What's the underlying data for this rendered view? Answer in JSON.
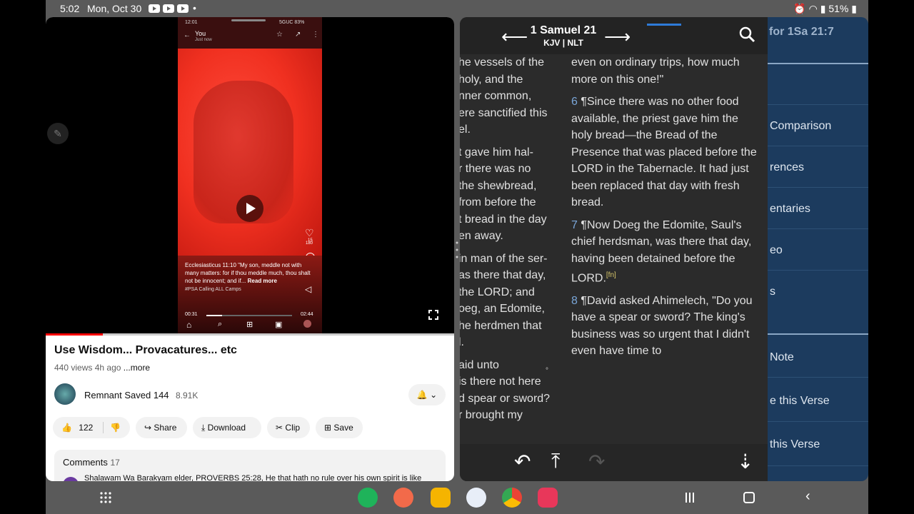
{
  "status_bar": {
    "time": "5:02",
    "date": "Mon, Oct 30",
    "battery": "51%"
  },
  "youtube": {
    "phone_overlay": {
      "carrier_time": "12:01",
      "carrier": "5GUC 83%",
      "user": "You",
      "posted": "Just now",
      "likes": "180",
      "comments": "15",
      "caption_ref": "Ecclesiasticus 11:10",
      "caption_text": "\"My son, meddle not with many matters: for if thou meddle much, thou shalt not be innocent; and if...",
      "read_more": "Read more",
      "hashtag": "#PSA Calling ALL Camps",
      "elapsed": "00:31",
      "duration": "02:44"
    },
    "progress_percent": 14,
    "title": "Use Wisdom... Provacatures... etc",
    "views": "440 views",
    "age": "4h ago",
    "more": "...more",
    "channel": "Remnant Saved 144",
    "subscribers": "8.91K",
    "actions": {
      "likes": "122",
      "share": "Share",
      "download": "Download",
      "clip": "Clip",
      "save": "Save"
    },
    "comments": {
      "label": "Comments",
      "count": "17",
      "preview": "Shalawam Wa Barakyam elder, PROVERBS 25:28, He that hath no rule over his own spirit is like"
    }
  },
  "bible": {
    "book_chapter": "1 Samuel 21",
    "versions": "KJV | NLT",
    "kjv_lines": [
      "he vessels of the",
      "holy, and the",
      "nner common,",
      "ere sanctified this",
      "el.",
      "",
      "t gave him hal-",
      "r there was no",
      " the shewbread,",
      "from before the",
      "t bread in the day",
      "en away.",
      "",
      "in man of the ser-",
      "as there that day,",
      " the LORD; and",
      "oeg, an Edomite,",
      "he herdmen that",
      "l.",
      "",
      "aid unto",
      " is there not here",
      "d spear or sword?",
      "r brought my"
    ],
    "nlt": [
      {
        "num": "",
        "text": "even on ordinary trips, how much more on this one!\""
      },
      {
        "num": "6",
        "text": "Since there was no other food available, the priest gave him the holy bread—the Bread of the Presence that was placed before the LORD in the Tabernacle. It had just been replaced that day with fresh bread."
      },
      {
        "num": "7",
        "text": "Now Doeg the Edomite, Saul's chief herdsman, was there that day, having been detained before the LORD.",
        "fn": "[fn]"
      },
      {
        "num": "8",
        "text": "David asked Ahimelech, \"Do you have a spear or sword? The king's business was so urgent that I didn't even have time to"
      }
    ],
    "pilcrow": "¶"
  },
  "menu": {
    "header": "for 1Sa 21:7",
    "items": [
      "Comparison",
      "rences",
      "entaries",
      "eo",
      "s",
      "Note",
      "e this Verse",
      "this Verse"
    ]
  },
  "dock": {
    "apps": [
      "phone-app",
      "contacts-app",
      "files-app",
      "messages-app",
      "chrome-app",
      "screen-recorder-app"
    ]
  }
}
